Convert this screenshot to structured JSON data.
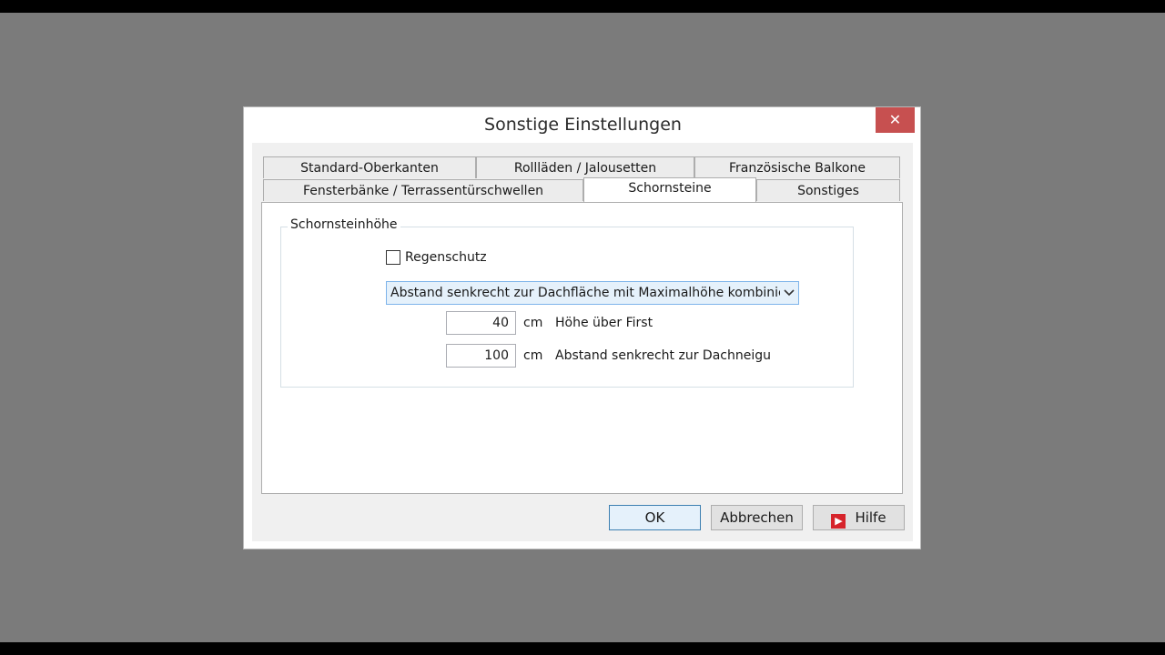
{
  "dialog": {
    "title": "Sonstige Einstellungen",
    "close_label": "✕"
  },
  "tabs": {
    "row1": [
      "Standard-Oberkanten",
      "Rollläden / Jalousetten",
      "Französische Balkone"
    ],
    "row2": [
      "Fensterbänke / Terrassentürschwellen",
      "Schornsteine",
      "Sonstiges"
    ],
    "active": "Schornsteine"
  },
  "group": {
    "label": "Schornsteinhöhe",
    "checkbox_label": "Regenschutz",
    "checkbox_checked": false,
    "combo_value": "Abstand senkrecht zur Dachfläche mit Maximalhöhe kombinieren",
    "field1": {
      "value": "40",
      "unit": "cm",
      "label": "Höhe über First"
    },
    "field2": {
      "value": "100",
      "unit": "cm",
      "label": "Abstand senkrecht zur Dachneigu"
    }
  },
  "buttons": {
    "ok": "OK",
    "cancel": "Abbrechen",
    "help": "Hilfe"
  },
  "colors": {
    "close_bg": "#c75050",
    "accent": "#3c7fb1",
    "help_icon": "#d6242b"
  }
}
